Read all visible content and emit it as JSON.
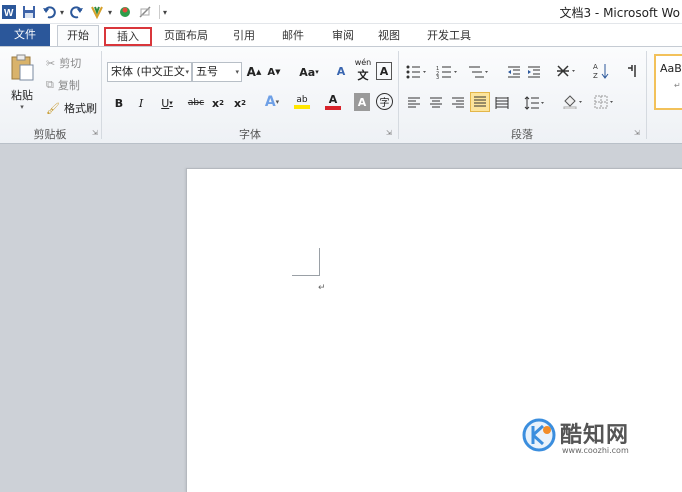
{
  "window": {
    "title": "文档3 - Microsoft Wo"
  },
  "qat": {
    "dropdown": "▾"
  },
  "tabs": {
    "file": "文件",
    "home": "开始",
    "insert": "插入",
    "page_layout": "页面布局",
    "references": "引用",
    "mailings": "邮件",
    "review": "审阅",
    "view": "视图",
    "developer": "开发工具"
  },
  "clipboard": {
    "paste": "粘贴",
    "cut": "剪切",
    "copy": "复制",
    "format_painter": "格式刷",
    "group_label": "剪贴板"
  },
  "font": {
    "font_name": "宋体 (中文正文",
    "font_size": "五号",
    "grow": "A",
    "shrink": "A",
    "change_case": "Aa",
    "clear_format": "A",
    "phonetic": "wén",
    "char_border": "A",
    "bold": "B",
    "italic": "I",
    "underline": "U",
    "strike": "abc",
    "subscript": "x",
    "superscript": "x",
    "text_effect": "A",
    "highlight": "ab",
    "font_color": "A",
    "char_shading": "A",
    "enclose": "字",
    "group_label": "字体"
  },
  "paragraph": {
    "group_label": "段落"
  },
  "styles": {
    "sample": "AaB",
    "mark": "↵"
  },
  "document": {
    "para_mark": "↵"
  },
  "watermark": {
    "name": "酷知网",
    "url": "www.coozhi.com"
  },
  "colors": {
    "accent": "#2b579a",
    "highlight_border": "#d9363b",
    "font_color": "#d8232a",
    "highlight_color": "#ffe600"
  }
}
